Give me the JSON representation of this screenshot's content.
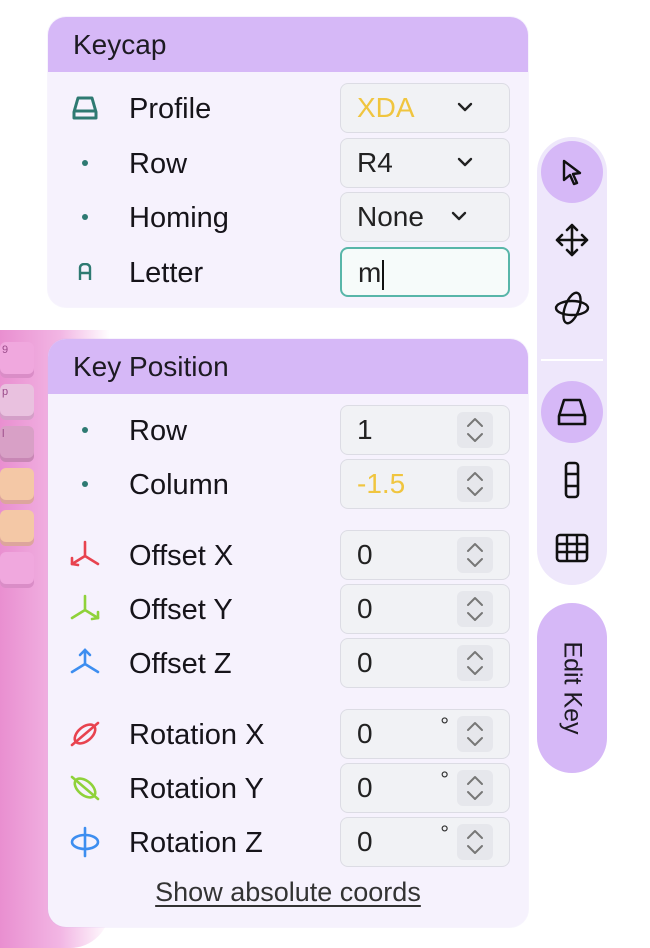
{
  "keycap_panel": {
    "title": "Keycap",
    "rows": [
      {
        "label": "Profile",
        "value": "XDA",
        "icon": "keycap-icon",
        "control": "select"
      },
      {
        "label": "Row",
        "value": "R4",
        "icon": "dot-icon",
        "control": "select"
      },
      {
        "label": "Homing",
        "value": "None",
        "icon": "dot-icon",
        "control": "select"
      },
      {
        "label": "Letter",
        "value": "m",
        "icon": "letter-icon",
        "control": "text"
      }
    ]
  },
  "position_panel": {
    "title": "Key Position",
    "rows": [
      {
        "label": "Row",
        "value": "1",
        "icon": "dot-icon"
      },
      {
        "label": "Column",
        "value": "-1.5",
        "icon": "dot-icon"
      },
      {
        "label": "Offset X",
        "value": "0",
        "icon": "offset-x-icon"
      },
      {
        "label": "Offset Y",
        "value": "0",
        "icon": "offset-y-icon"
      },
      {
        "label": "Offset Z",
        "value": "0",
        "icon": "offset-z-icon"
      },
      {
        "label": "Rotation X",
        "value": "0",
        "unit": "°",
        "icon": "rotation-x-icon"
      },
      {
        "label": "Rotation Y",
        "value": "0",
        "unit": "°",
        "icon": "rotation-y-icon"
      },
      {
        "label": "Rotation Z",
        "value": "0",
        "unit": "°",
        "icon": "rotation-z-icon"
      }
    ],
    "link": "Show absolute coords"
  },
  "toolbar": {
    "tools": [
      "pointer-icon",
      "move-icon",
      "rotate-icon",
      "keycap-tool-icon",
      "column-tool-icon",
      "grid-tool-icon"
    ],
    "active": [
      "pointer-icon",
      "keycap-tool-icon"
    ]
  },
  "edit_key": {
    "label": "Edit Key"
  },
  "background_keys": [
    "9",
    "p",
    "l"
  ],
  "colors": {
    "header": "#d6b8f7",
    "panel": "#f6f2fd",
    "modified_value": "#f0c53f",
    "focus": "#58b6a9",
    "axis_x": "#e8434f",
    "axis_y": "#8fd23a",
    "axis_z": "#3d8ef0"
  }
}
